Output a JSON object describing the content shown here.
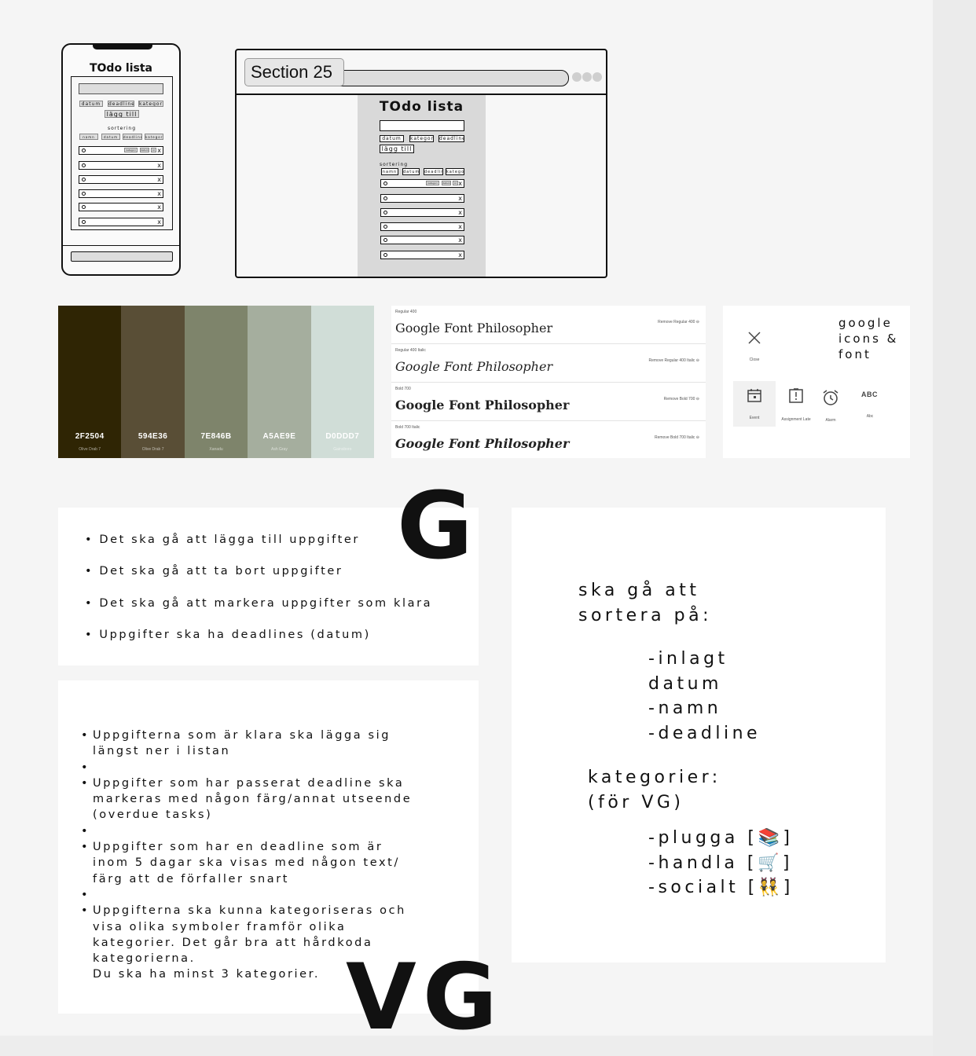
{
  "phone_mockup": {
    "title": "TOdo lista",
    "buttons": [
      "datum",
      "deadline",
      "kategori"
    ],
    "add_button": "lägg till",
    "sort_label": "sortering",
    "sort_buttons": [
      "namn",
      "datum",
      "deadline",
      "kategori"
    ],
    "first_row_tags": [
      "kategori",
      "datum",
      "kl"
    ],
    "close_glyph": "x"
  },
  "browser_mockup": {
    "tab_label": "Section 25",
    "title": "TOdo lista",
    "buttons": [
      "datum",
      "kategori",
      "deadline"
    ],
    "add_button": "lägg till",
    "sort_label": "sortering",
    "sort_buttons": [
      "namn",
      "datum",
      "deadline",
      "kategori"
    ],
    "first_row_tags": [
      "kategori",
      "datum",
      "kl"
    ],
    "close_glyph": "x"
  },
  "palette": [
    {
      "hex": "2F2504",
      "name": "Olive Drab 7",
      "color": "#2F2504"
    },
    {
      "hex": "594E36",
      "name": "Olive Drab 7",
      "color": "#594E36"
    },
    {
      "hex": "7E846B",
      "name": "Xanadu",
      "color": "#7E846B"
    },
    {
      "hex": "A5AE9E",
      "name": "Ash Gray",
      "color": "#A5AE9E"
    },
    {
      "hex": "D0DDD7",
      "name": "Gainsboro",
      "color": "#D0DDD7"
    }
  ],
  "fonts": [
    {
      "label": "Regular 400",
      "sample": "Google Font Philosopher",
      "remove": "Remove Regular 400"
    },
    {
      "label": "Regular 400 Italic",
      "sample": "Google Font Philosopher",
      "remove": "Remove Regular 400 Italic"
    },
    {
      "label": "Bold 700",
      "sample": "Google Font Philosopher",
      "remove": "Remove Bold 700"
    },
    {
      "label": "Bold 700 Italic",
      "sample": "Google Font Philosopher",
      "remove": "Remove Bold 700 Italic"
    }
  ],
  "icons_panel": {
    "title_lines": [
      "google",
      "icons &",
      "font"
    ],
    "icons": [
      {
        "name": "close-icon",
        "label": "Close"
      },
      {
        "name": "event-icon",
        "label": "Event"
      },
      {
        "name": "assignment-late-icon",
        "label": "Assignment Late"
      },
      {
        "name": "alarm-icon",
        "label": "Alarm"
      },
      {
        "name": "abc-icon",
        "label": "Abc",
        "glyph": "ABC"
      }
    ]
  },
  "g_requirements": {
    "grade": "G",
    "items": [
      "Det ska gå att lägga till uppgifter",
      "Det ska gå att ta bort uppgifter",
      "Det ska gå att markera uppgifter som klara",
      "Uppgifter ska ha deadlines (datum)"
    ]
  },
  "vg_requirements": {
    "grade": "VG",
    "items": [
      "Uppgifterna som är klara ska lägga sig\nlängst ner i listan",
      "",
      "Uppgifter som har passerat deadline ska\nmarkeras med någon färg/annat utseende\n(overdue tasks)",
      "",
      "Uppgifter som har en deadline som är\ninom 5 dagar ska visas med någon text/\nfärg att de förfaller snart",
      "",
      "Uppgifterna ska kunna kategoriseras och\nvisa olika symboler framför olika\nkategorier. Det går bra att hårdkoda\nkategorierna.\nDu ska ha minst 3 kategorier."
    ]
  },
  "sorting": {
    "heading": "ska gå att\nsortera på:",
    "options": "-inlagt\ndatum\n-namn\n-deadline",
    "categories_heading": "kategorier:\n(för VG)",
    "categories": "-plugga [📚]\n-handla [🛒]\n-socialt [👯]"
  },
  "bullet": "•"
}
